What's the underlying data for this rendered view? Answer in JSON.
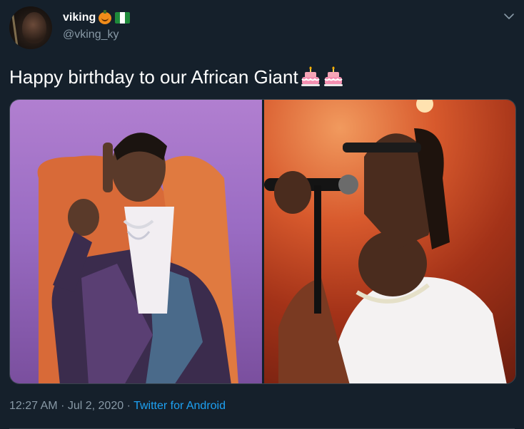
{
  "author": {
    "display_name": "viking",
    "emoji_1": "jack-o-lantern-icon",
    "emoji_2": "nigeria-flag-icon",
    "handle": "@vking_ky"
  },
  "tweet": {
    "text": "Happy birthday to our African Giant",
    "trailing_emoji": [
      "birthday-cake-icon",
      "birthday-cake-icon"
    ]
  },
  "media": {
    "count": 2,
    "images": [
      "photo-1",
      "photo-2"
    ]
  },
  "meta": {
    "time": "12:27 AM",
    "dot_1": "·",
    "date": "Jul 2, 2020",
    "dot_2": "·",
    "source": "Twitter for Android"
  },
  "colors": {
    "background": "#15202b",
    "text_primary": "#ffffff",
    "text_secondary": "#8899a6",
    "link": "#1da1f2",
    "border": "#38444d"
  }
}
